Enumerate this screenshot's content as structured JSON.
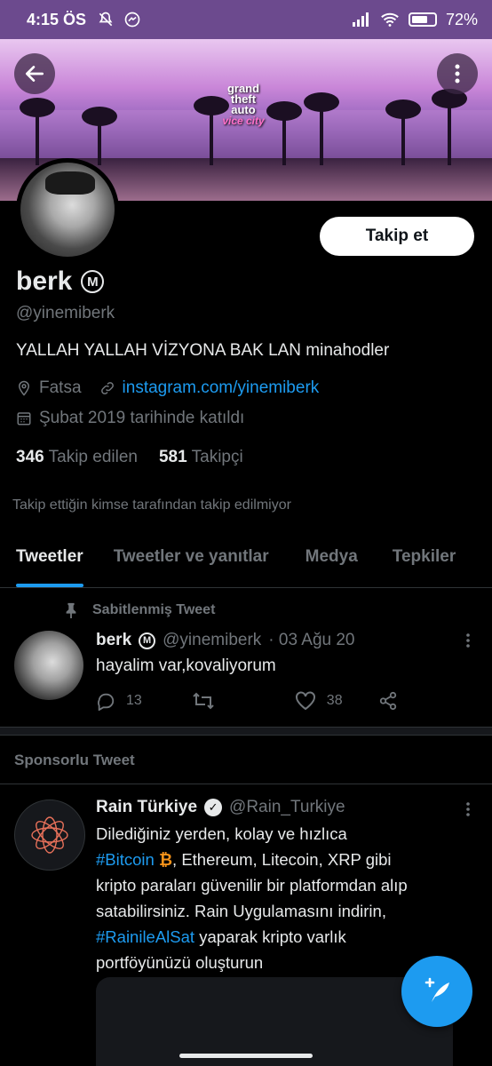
{
  "status_bar": {
    "time": "4:15 ÖS",
    "battery": "72%",
    "battery_level": 0.72
  },
  "banner": {
    "logo_lines": [
      "grand",
      "theft",
      "auto"
    ],
    "logo_sub": "vice city"
  },
  "profile": {
    "follow_label": "Takip et",
    "name": "berk",
    "badge": "M",
    "handle": "@yinemiberk",
    "bio": "YALLAH YALLAH VİZYONA BAK LAN minahodler",
    "location": "Fatsa",
    "link": "instagram.com/yinemiberk",
    "joined": "Şubat 2019 tarihinde katıldı",
    "following_count": "346",
    "following_label": "Takip edilen",
    "followers_count": "581",
    "followers_label": "Takipçi",
    "not_followed_note": "Takip ettiğin kimse tarafından takip edilmiyor"
  },
  "tabs": [
    {
      "label": "Tweetler",
      "active": true
    },
    {
      "label": "Tweetler ve yanıtlar",
      "active": false
    },
    {
      "label": "Medya",
      "active": false
    },
    {
      "label": "Tepkiler",
      "active": false
    }
  ],
  "pinned_tweet": {
    "pinned_label": "Sabitlenmiş Tweet",
    "name": "berk",
    "badge": "M",
    "handle": "@yinemiberk",
    "date": "· 03 Ağu 20",
    "text": "hayalim var,kovaliyorum",
    "replies": "13",
    "likes": "38"
  },
  "sponsored": {
    "header": "Sponsorlu Tweet",
    "name": "Rain Türkiye",
    "handle": "@Rain_Turkiye",
    "line1": "Dilediğiniz yerden, kolay ve hızlıca",
    "hashtag1": "#Bitcoin",
    "btc_symbol": "₿",
    "line2_rest": ", Ethereum, Litecoin, XRP gibi",
    "line3": "kripto paraları güvenilir bir platformdan alıp",
    "line4": "satabilirsiniz. Rain Uygulamasını indirin,",
    "hashtag2": "#RainileAlSat",
    "line5_rest": " yaparak kripto varlık",
    "line6": "portföyünüzü oluşturun"
  },
  "colors": {
    "accent": "#1d9bf0",
    "muted": "#71767b",
    "text": "#e7e9ea",
    "status_bar": "#6c4a8e",
    "bitcoin": "#f7931a"
  },
  "icons": [
    "back-arrow-icon",
    "more-vertical-icon",
    "location-pin-icon",
    "link-icon",
    "calendar-icon",
    "pin-icon",
    "reply-icon",
    "retweet-icon",
    "like-icon",
    "share-icon",
    "verified-icon",
    "compose-tweet-icon"
  ]
}
